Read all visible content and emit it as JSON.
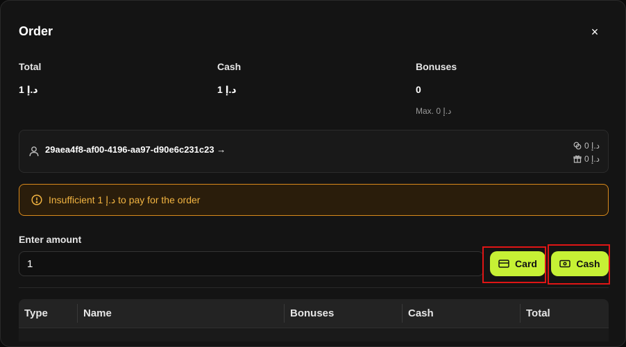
{
  "modal": {
    "title": "Order",
    "close_glyph": "×"
  },
  "stats": [
    {
      "label": "Total",
      "value": "1 د.إ"
    },
    {
      "label": "Cash",
      "value": "1 د.إ"
    },
    {
      "label": "Bonuses",
      "value": "0",
      "sub": "Max. 0 د.إ"
    }
  ],
  "user": {
    "id": "29aea4f8-af00-4196-aa97-d90e6c231c23",
    "arrow": "→",
    "cash_balance": "0 د.إ",
    "bonus_balance": "0 د.إ"
  },
  "warning": {
    "text": "Insufficient 1 د.إ to pay for the order",
    "color": "#f2b441"
  },
  "amount": {
    "label": "Enter amount",
    "value": "1"
  },
  "buttons": {
    "card": "Card",
    "cash": "Cash",
    "accent": "#c6f135"
  },
  "table": {
    "headers": [
      "Type",
      "Name",
      "Bonuses",
      "Cash",
      "Total"
    ]
  }
}
